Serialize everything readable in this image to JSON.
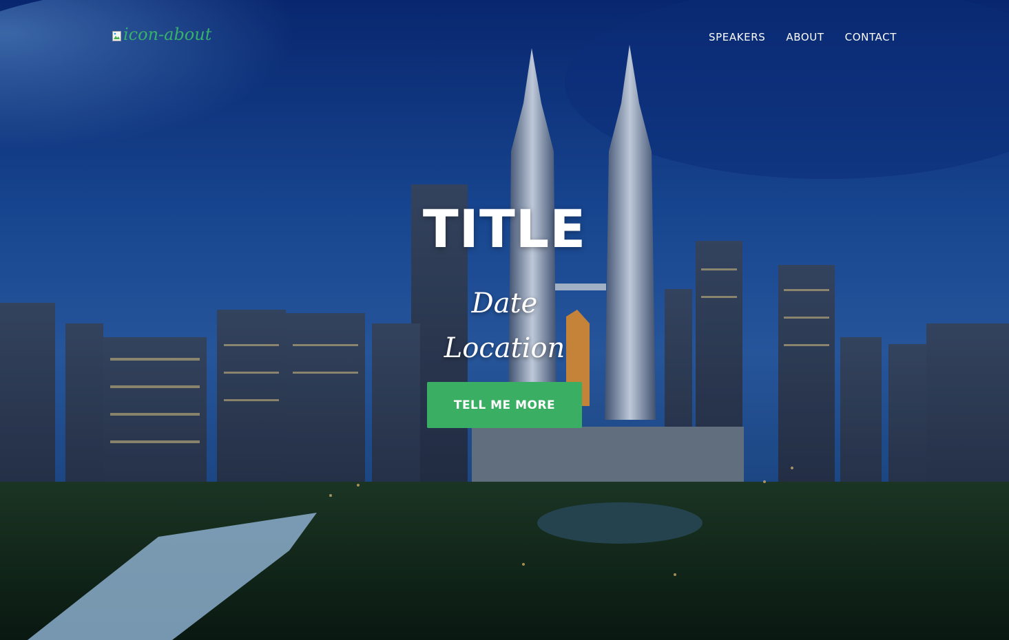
{
  "nav": {
    "brand_alt": "icon-about",
    "links": [
      "SPEAKERS",
      "ABOUT",
      "CONTACT"
    ]
  },
  "hero": {
    "title": "TITLE",
    "date": "Date",
    "location": "Location",
    "cta_label": "TELL ME MORE"
  },
  "colors": {
    "accent": "#3aaf63",
    "brand_text": "#37b26a",
    "sky_top": "#0a2a78",
    "sky_mid": "#1f5aa8"
  },
  "icons": {
    "brand": "broken-image-icon"
  }
}
